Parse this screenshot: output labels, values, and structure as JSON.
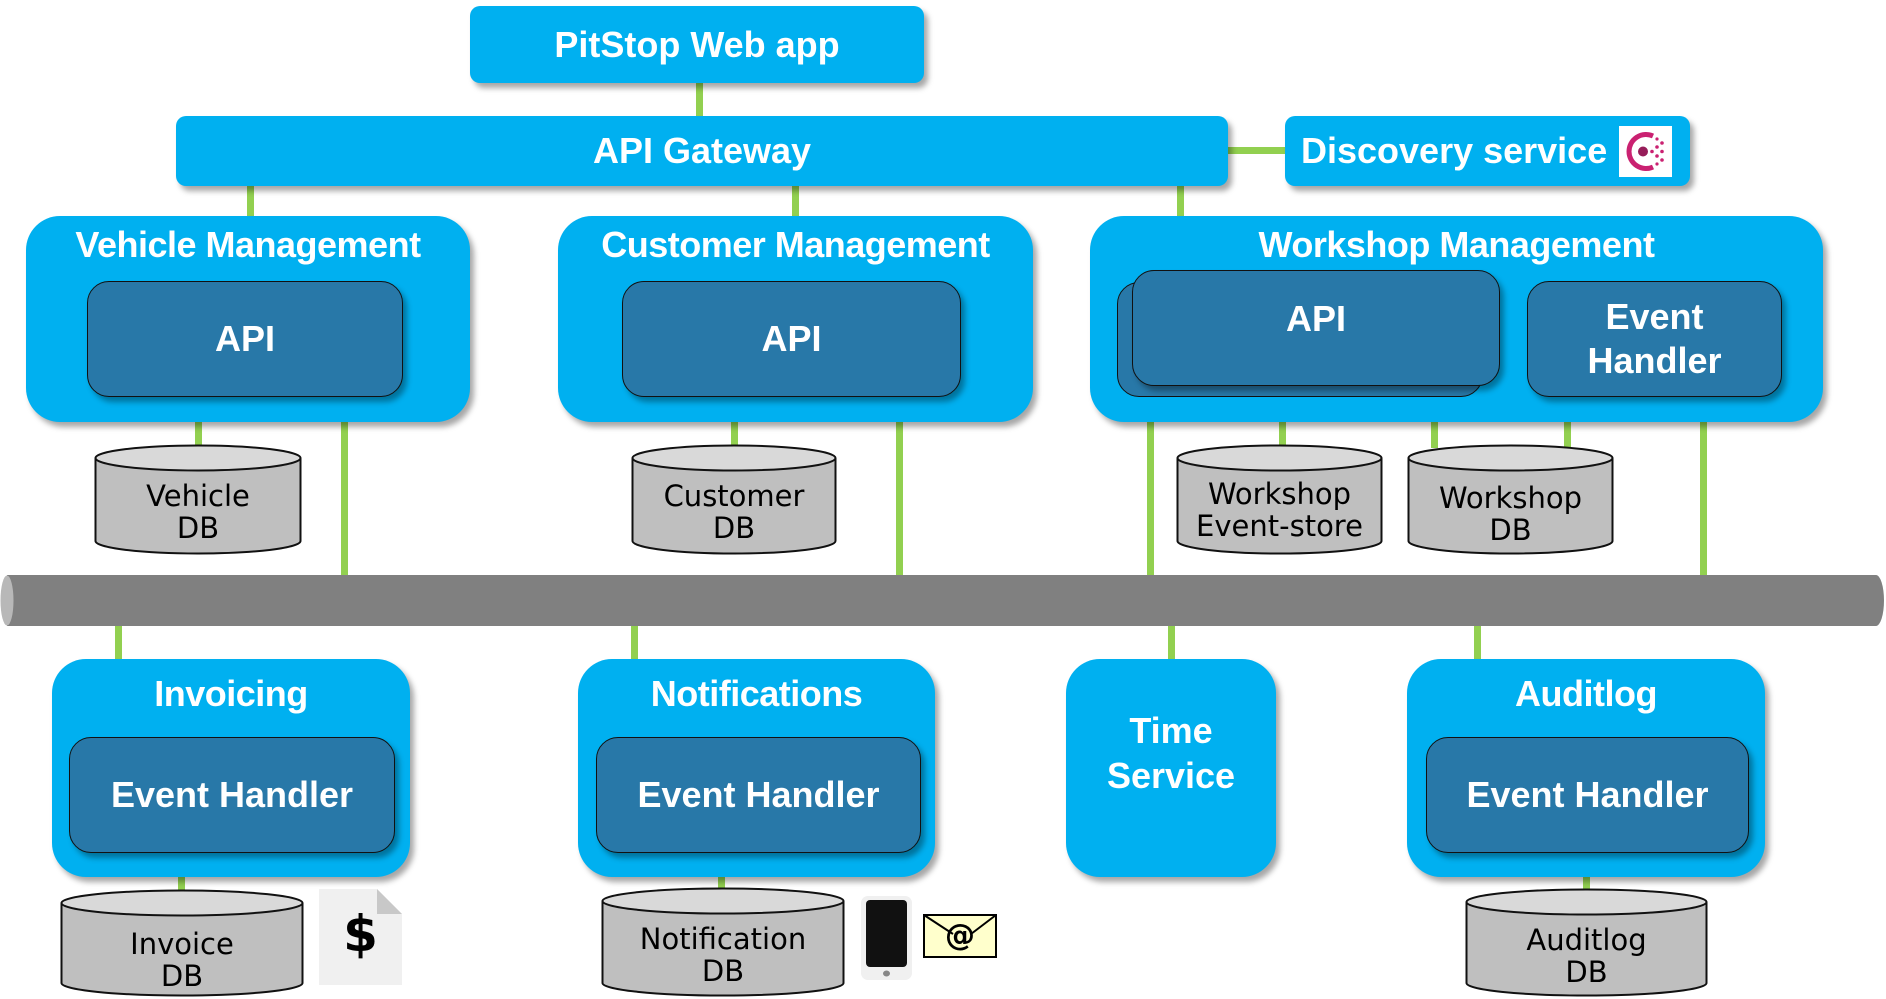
{
  "diagram": {
    "colors": {
      "service": "#00b0f0",
      "component": "#2878a8",
      "connector": "#92d050",
      "bus": "#808080",
      "database": "#bfbfbf"
    },
    "web_app": {
      "label": "PitStop Web app"
    },
    "api_gateway": {
      "label": "API Gateway"
    },
    "discovery_service": {
      "label": "Discovery service",
      "icon": "consul-logo-icon"
    },
    "services_top": [
      {
        "name": "Vehicle Management",
        "components": [
          {
            "label": "API"
          }
        ],
        "databases": [
          {
            "line1": "Vehicle",
            "line2": "DB"
          }
        ]
      },
      {
        "name": "Customer Management",
        "components": [
          {
            "label": "API"
          }
        ],
        "databases": [
          {
            "line1": "Customer",
            "line2": "DB"
          }
        ]
      },
      {
        "name": "Workshop Management",
        "components": [
          {
            "label": "API",
            "stacked": true
          },
          {
            "line1": "Event",
            "line2": "Handler"
          }
        ],
        "databases": [
          {
            "line1": "Workshop",
            "line2": "Event-store"
          },
          {
            "line1": "Workshop",
            "line2": "DB"
          }
        ]
      }
    ],
    "message_bus": {
      "label": ""
    },
    "services_bottom": [
      {
        "name": "Invoicing",
        "components": [
          {
            "label": "Event Handler"
          }
        ],
        "databases": [
          {
            "line1": "Invoice",
            "line2": "DB"
          }
        ],
        "extras": [
          {
            "icon": "invoice-dollar-icon",
            "glyph": "$"
          }
        ]
      },
      {
        "name": "Notifications",
        "components": [
          {
            "label": "Event Handler"
          }
        ],
        "databases": [
          {
            "line1": "Notification",
            "line2": "DB"
          }
        ],
        "extras": [
          {
            "icon": "smartphone-icon"
          },
          {
            "icon": "email-icon",
            "glyph": "@"
          }
        ]
      },
      {
        "name_line1": "Time",
        "name_line2": "Service"
      },
      {
        "name": "Auditlog",
        "components": [
          {
            "label": "Event Handler"
          }
        ],
        "databases": [
          {
            "line1": "Auditlog",
            "line2": "DB"
          }
        ]
      }
    ]
  }
}
